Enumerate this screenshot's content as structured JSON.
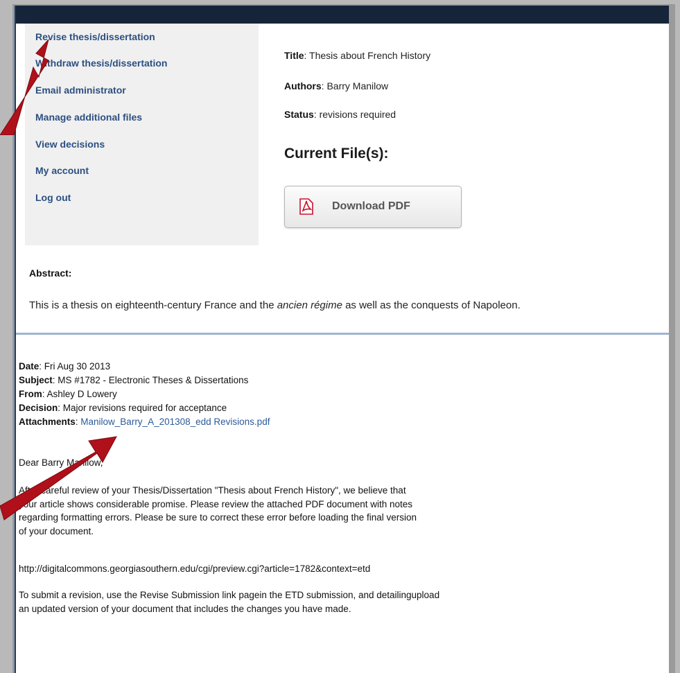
{
  "sidebar": {
    "items": [
      {
        "label": "Revise thesis/dissertation"
      },
      {
        "label": "Withdraw thesis/dissertation"
      },
      {
        "label": "Email administrator"
      },
      {
        "label": "Manage additional files"
      },
      {
        "label": "View decisions"
      },
      {
        "label": "My account"
      },
      {
        "label": "Log out"
      }
    ]
  },
  "submission": {
    "title_label": "Title",
    "title": ": Thesis about French History",
    "authors_label": "Authors",
    "authors": ": Barry Manilow",
    "status_label": "Status",
    "status": ": revisions required",
    "files_heading": "Current File(s):",
    "download_label": "Download PDF"
  },
  "abstract": {
    "label": "Abstract:",
    "text_before": "This is a thesis on eighteenth-century France and the ",
    "text_italic": "ancien régime",
    "text_after": " as well as the conquests of Napoleon."
  },
  "email": {
    "date_label": "Date",
    "date": ": Fri Aug 30 2013",
    "subject_label": "Subject",
    "subject": ": MS #1782 - Electronic Theses & Dissertations",
    "from_label": "From",
    "from": ": Ashley D Lowery",
    "decision_label": "Decision",
    "decision": ": Major revisions required for acceptance",
    "attachments_label": "Attachments",
    "attachments_sep": ": ",
    "attachment_file": "Manilow_Barry_A_201308_edd Revisions.pdf",
    "greeting": "Dear Barry Manilow,",
    "body_lines": [
      "After careful review of your Thesis/Dissertation \"Thesis about French History\", we believe that",
      "your article shows considerable promise. Please review the attached PDF document with notes",
      "regarding formatting errors. Please be sure to correct these error before loading the final version",
      "of your document."
    ],
    "preview_url": "http://digitalcommons.georgiasouthern.edu/cgi/preview.cgi?article=1782&context=etd",
    "closing_lines": [
      "To submit a revision, use the Revise Submission link pagein the ETD submission, and detailingupload",
      "an updated version of your document that includes the changes you have made."
    ]
  },
  "colors": {
    "topbar": "#16243a",
    "link": "#2c4f80",
    "arrow": "#b0101a"
  }
}
